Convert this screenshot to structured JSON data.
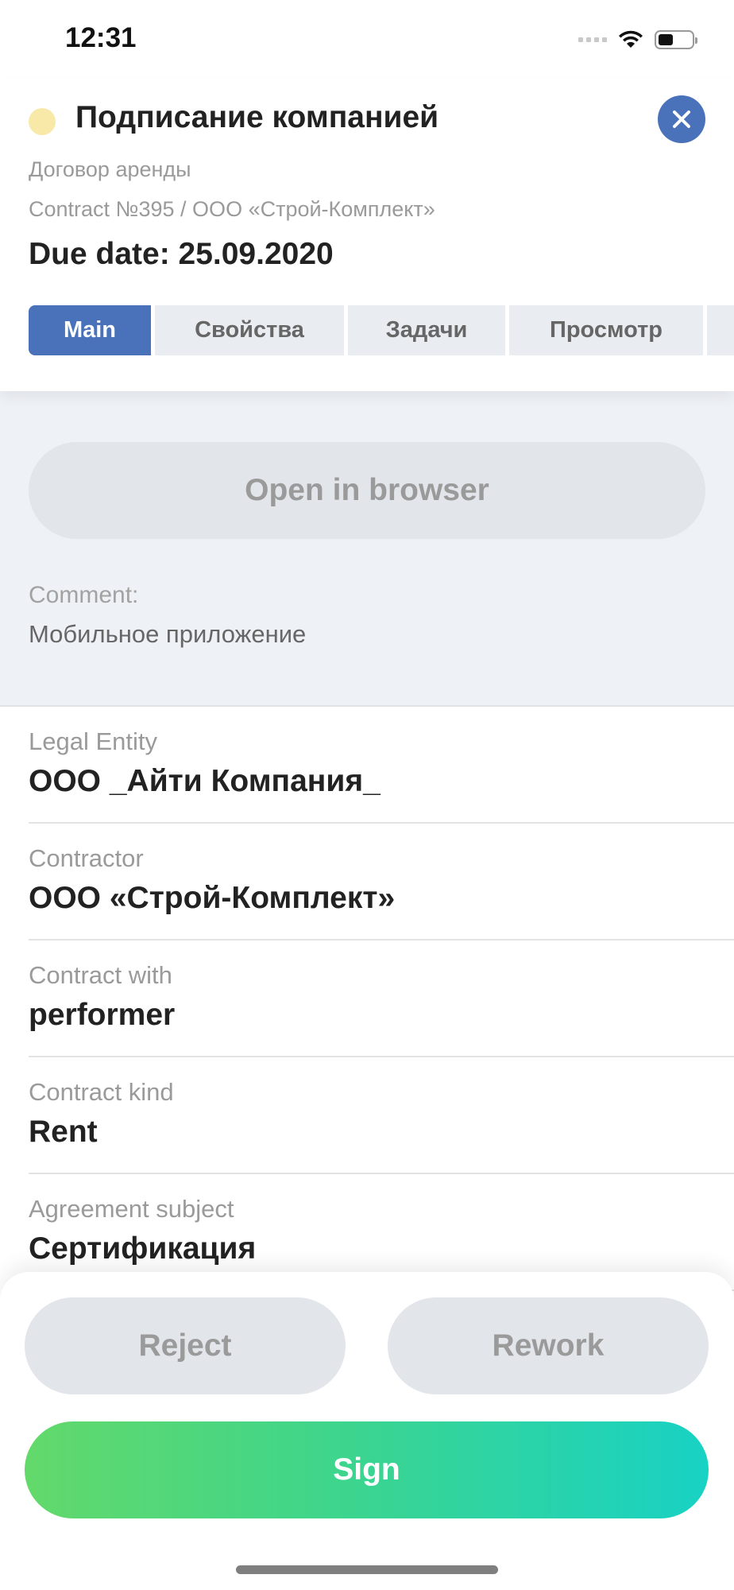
{
  "status_bar": {
    "time": "12:31",
    "battery_level_percent": 45
  },
  "header": {
    "title": "Подписание компанией",
    "status_color": "#f9e9a8",
    "doc_type": "Договор аренды",
    "contract_ref": "Contract №395 / ООО «Строй-Комплект»",
    "due_date": "Due date: 25.09.2020",
    "close_icon": "close-icon",
    "accent_color": "#4a72bb",
    "tabs": [
      {
        "label": "Main",
        "active": true
      },
      {
        "label": "Свойства",
        "active": false
      },
      {
        "label": "Задачи",
        "active": false
      },
      {
        "label": "Просмотр",
        "active": false
      },
      {
        "label": "",
        "active": false
      }
    ]
  },
  "panel": {
    "open_browser_label": "Open in browser",
    "comment_label": "Comment:",
    "comment_value": "Мобильное приложение"
  },
  "fields": [
    {
      "label": "Legal Entity",
      "value": "ООО _Айти Компания_"
    },
    {
      "label": "Contractor",
      "value": "ООО «Строй-Комплект»"
    },
    {
      "label": "Contract with",
      "value": "performer"
    },
    {
      "label": "Contract kind",
      "value": "Rent"
    },
    {
      "label": "Agreement subject",
      "value": "Сертификация"
    }
  ],
  "actions": {
    "reject_label": "Reject",
    "rework_label": "Rework",
    "sign_label": "Sign"
  }
}
